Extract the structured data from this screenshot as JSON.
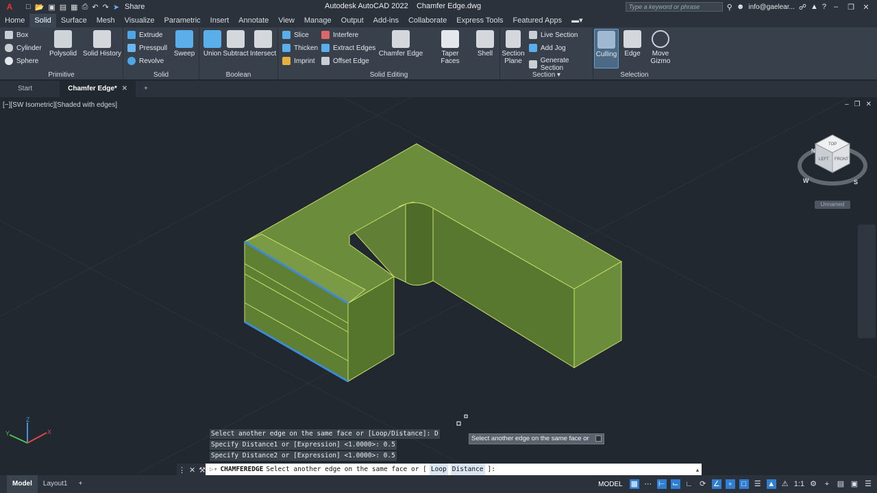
{
  "title": {
    "app_name": "Autodesk AutoCAD 2022",
    "document": "Chamfer Edge.dwg",
    "share_label": "Share",
    "search_placeholder": "Type a keyword or phrase",
    "user": "info@gaelear..."
  },
  "menu": {
    "tabs": [
      "Home",
      "Solid",
      "Surface",
      "Mesh",
      "Visualize",
      "Parametric",
      "Insert",
      "Annotate",
      "View",
      "Manage",
      "Output",
      "Add-ins",
      "Collaborate",
      "Express Tools",
      "Featured Apps"
    ],
    "active": "Solid"
  },
  "ribbon": {
    "primitive": {
      "title": "Primitive",
      "box": "Box",
      "cylinder": "Cylinder",
      "sphere": "Sphere",
      "polysolid": "Polysolid"
    },
    "solid": {
      "title": "Solid",
      "solid_history": "Solid History",
      "extrude": "Extrude",
      "presspull": "Presspull",
      "revolve": "Revolve",
      "sweep": "Sweep"
    },
    "boolean": {
      "title": "Boolean",
      "union": "Union",
      "subtract": "Subtract",
      "intersect": "Intersect"
    },
    "solid_editing": {
      "title": "Solid Editing",
      "slice": "Slice",
      "thicken": "Thicken",
      "imprint": "Imprint",
      "interfere": "Interfere",
      "extract_edges": "Extract Edges",
      "offset_edge": "Offset Edge",
      "chamfer_edge": "Chamfer Edge",
      "taper_faces": "Taper Faces",
      "shell": "Shell"
    },
    "section": {
      "title": "Section",
      "section_plane_1": "Section",
      "section_plane_2": "Plane",
      "live_section": "Live Section",
      "add_jog": "Add Jog",
      "generate_section": "Generate Section"
    },
    "selection": {
      "title": "Selection",
      "culling": "Culling",
      "edge": "Edge",
      "move_gizmo_1": "Move",
      "move_gizmo_2": "Gizmo"
    }
  },
  "doc_tabs": {
    "start": "Start",
    "active": "Chamfer Edge*",
    "add": "+"
  },
  "viewport": {
    "label": "[−][SW Isometric][Shaded with edges]",
    "viewcube": {
      "top": "TOP",
      "left": "LEFT",
      "front": "FRONT",
      "compass_w": "W",
      "compass_s": "S",
      "compass_n": "N"
    },
    "ucs_name": "Unnamed",
    "axis_x": "X",
    "axis_y": "Y",
    "axis_z": "Z"
  },
  "command": {
    "history": [
      "Select another edge on the same face or [Loop/Distance]: D",
      "Specify Distance1 or [Expression] <1.0000>: 0.5",
      "Specify Distance2 or [Expression] <1.0000>: 0.5"
    ],
    "tooltip": "Select another edge on the same face or",
    "name": "CHAMFEREDGE",
    "prompt": "Select another edge on the same face or [",
    "option_loop": "Loop",
    "option_distance": "Distance",
    "prompt_end": "]:"
  },
  "status": {
    "tabs": [
      "Model",
      "Layout1"
    ],
    "active": "Model",
    "add": "+",
    "model_label": "MODEL",
    "scale": "1:1"
  },
  "colors": {
    "solid_face": "#6b8c3a",
    "solid_edge": "#c8e06a",
    "selected_edge": "#3c8ad8",
    "viewport_bg": "#212830",
    "accent": "#2f7ed1"
  }
}
